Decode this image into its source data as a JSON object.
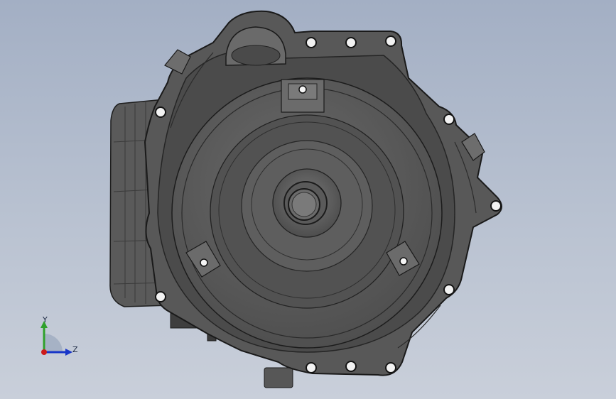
{
  "viewport": {
    "background_top": "#a3afc4",
    "background_bottom": "#c9cfda",
    "model_color": "#595959"
  },
  "triad": {
    "y_label": "Y",
    "z_label": "Z",
    "y_color": "#2fa12b",
    "z_color": "#1836c8",
    "origin_color": "#cc1a1a"
  },
  "icons": [
    "transmission-housing-model",
    "coordinate-triad-icon"
  ]
}
